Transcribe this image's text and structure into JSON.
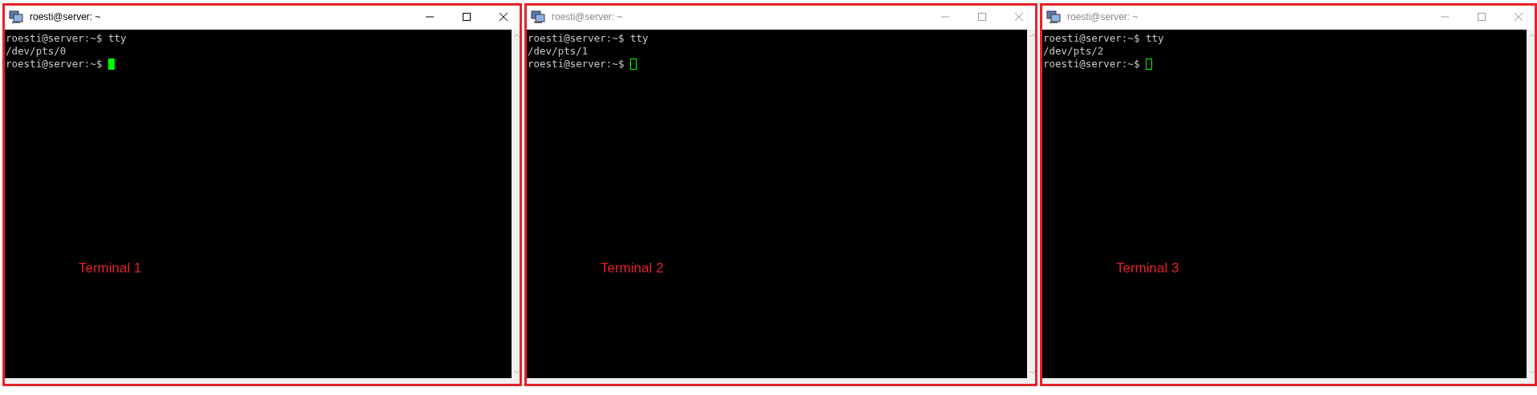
{
  "windows": [
    {
      "title": "roesti@server: ~",
      "active": true,
      "lines": [
        "roesti@server:~$ tty",
        "/dev/pts/0"
      ],
      "prompt": "roesti@server:~$",
      "annotation": "Terminal 1"
    },
    {
      "title": "roesti@server: ~",
      "active": false,
      "lines": [
        "roesti@server:~$ tty",
        "/dev/pts/1"
      ],
      "prompt": "roesti@server:~$",
      "annotation": "Terminal 2"
    },
    {
      "title": "roesti@server: ~",
      "active": false,
      "lines": [
        "roesti@server:~$ tty",
        "/dev/pts/2"
      ],
      "prompt": "roesti@server:~$",
      "annotation": "Terminal 3"
    }
  ]
}
